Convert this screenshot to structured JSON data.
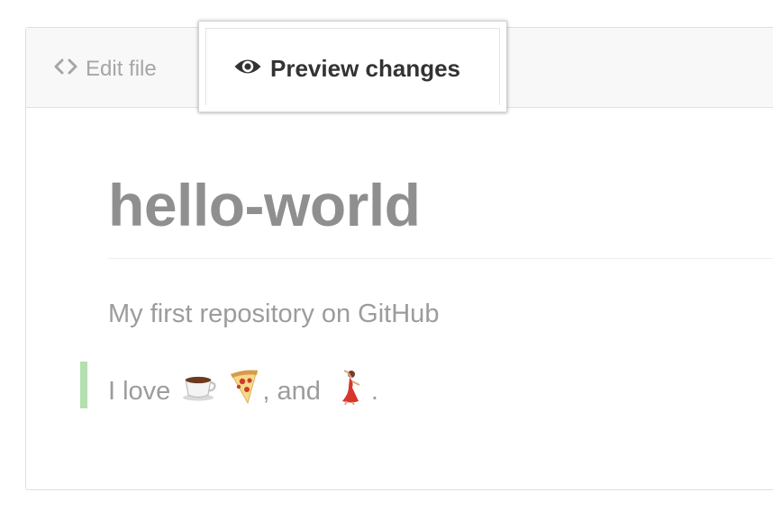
{
  "tabs": {
    "edit_file_label": "Edit file",
    "preview_changes_label": "Preview changes"
  },
  "preview": {
    "title": "hello-world",
    "description": "My first repository on GitHub",
    "love_line": {
      "prefix": "I love",
      "emoji_1": "coffee-emoji",
      "emoji_2": "pizza-emoji",
      "middle": ", and",
      "emoji_3": "dancer-emoji",
      "suffix": "."
    }
  },
  "colors": {
    "added_line_marker": "#b4dfae",
    "title_text": "#8f8f8f",
    "body_text": "#9c9c9c",
    "active_tab_text": "#333333",
    "inactive_tab_text": "#a6a6a6"
  },
  "icons": {
    "edit_tab": "code-icon",
    "preview_tab": "eye-icon"
  }
}
